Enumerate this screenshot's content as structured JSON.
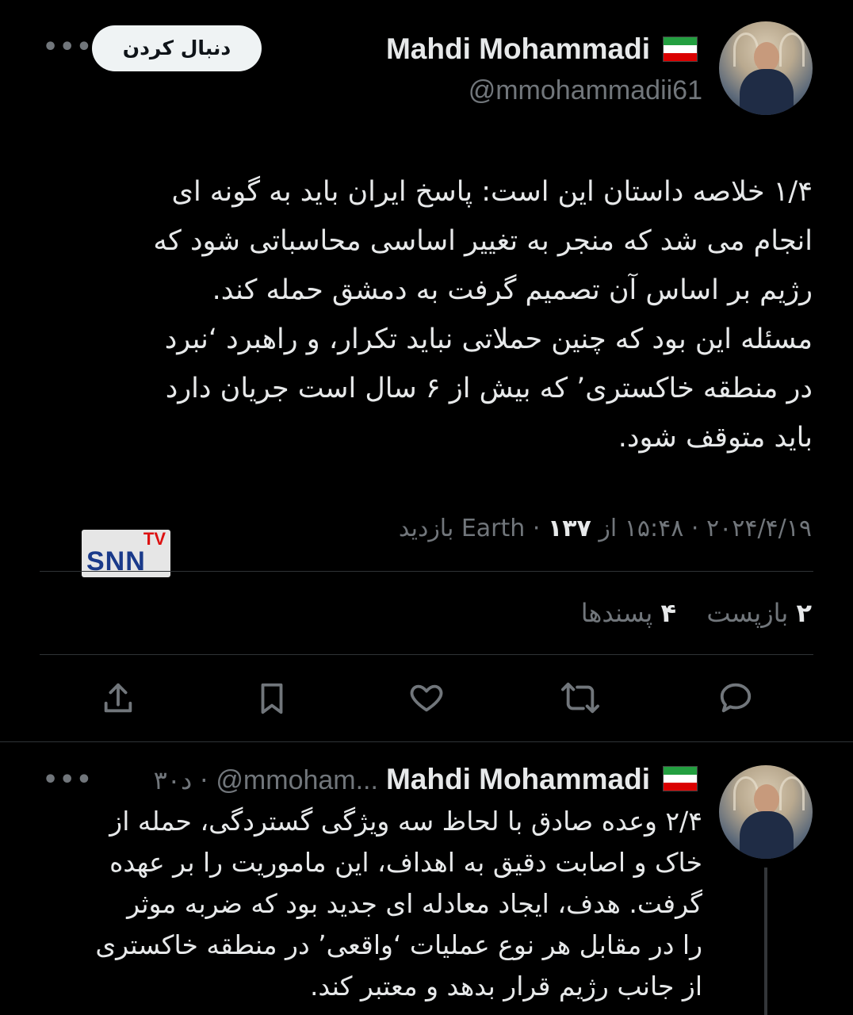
{
  "tweet": {
    "author_name": "Mahdi Mohammadi",
    "author_handle": "@mmohammadii61",
    "follow_label": "دنبال کردن",
    "more_icon": "more-icon",
    "text": "۱/۴ خلاصه داستان این است: پاسخ ایران باید به گونه ای\nانجام می شد که منجر به تغییر اساسی محاسباتی شود که\nرژیم بر اساس آن تصمیم گرفت به دمشق حمله کند.\nمسئله این بود که چنین حملاتی نباید تکرار، و راهبرد ‘نبرد\nدر منطقه خاکستری’ که بیش از ۶ سال است جریان دارد\nباید متوقف شود.",
    "meta": {
      "date": "۲۰۲۴/۴/۱۹",
      "time": "۱۵:۴۸",
      "source": "از Earth",
      "views_count": "۱۳۷",
      "views_label": "بازدید",
      "separator": "·"
    },
    "watermark": {
      "top": "TV",
      "main": "SNN"
    },
    "stats": {
      "reposts_count": "۲",
      "reposts_label": "بازپست",
      "likes_count": "۴",
      "likes_label": "پسندها"
    },
    "actions": [
      "reply-icon",
      "retweet-icon",
      "like-icon",
      "bookmark-icon",
      "share-icon"
    ]
  },
  "reply": {
    "author_name": "Mahdi Mohammadi",
    "author_handle": "@mmoham...",
    "time_ago": "۳۰د",
    "separator": "·",
    "text": "۲/۴ وعده صادق با لحاظ سه ویژگی گستردگی، حمله از\nخاک و اصابت دقیق به اهداف، این ماموریت را بر عهده\nگرفت. هدف، ایجاد معادله ای جدید بود که ضربه موثر\nرا در مقابل هر نوع عملیات ‘واقعی’ در منطقه خاکستری\nاز جانب رژیم قرار بدهد و معتبر کند."
  },
  "colors": {
    "background": "#000000",
    "text": "#e7e9ea",
    "muted": "#71767b",
    "divider": "#2f3336",
    "button_bg": "#eff3f4",
    "flag_green": "#239f40",
    "flag_white": "#ffffff",
    "flag_red": "#da0000"
  }
}
